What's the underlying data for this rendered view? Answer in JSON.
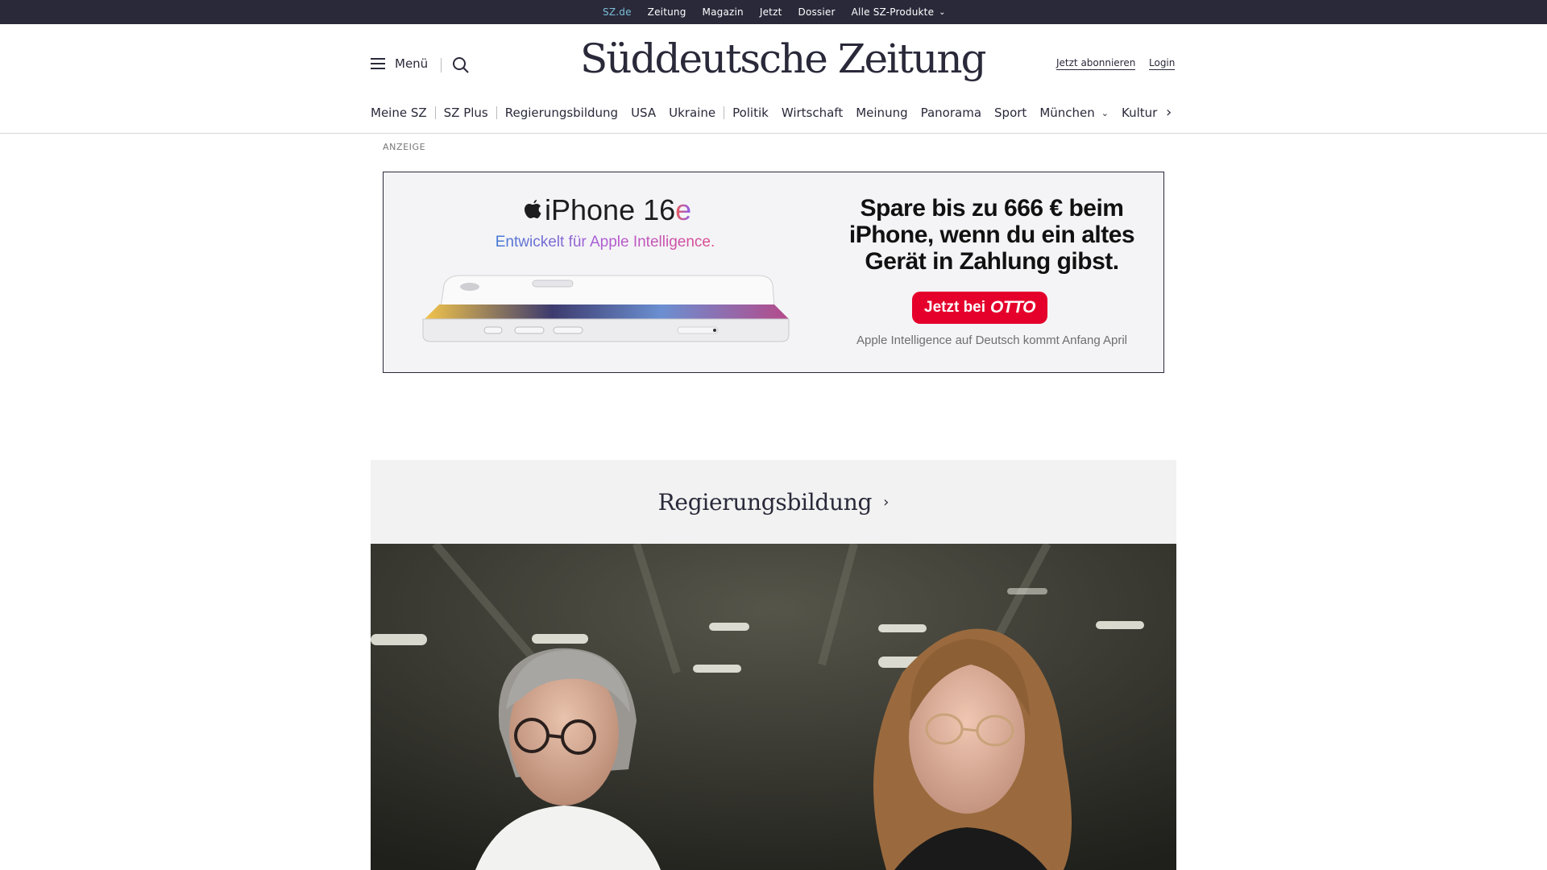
{
  "topbar": {
    "items": [
      "SZ.de",
      "Zeitung",
      "Magazin",
      "Jetzt",
      "Dossier",
      "Alle SZ-Produkte"
    ],
    "active": "SZ.de"
  },
  "header": {
    "menu_label": "Menü",
    "logo": "Süddeutsche Zeitung",
    "subscribe": "Jetzt abonnieren",
    "login": "Login"
  },
  "nav": {
    "items": [
      "Meine SZ",
      "SZ Plus",
      "Regierungsbildung",
      "USA",
      "Ukraine",
      "Politik",
      "Wirtschaft",
      "Meinung",
      "Panorama",
      "Sport",
      "München",
      "Kultur"
    ]
  },
  "ad": {
    "label": "ANZEIGE",
    "product": "iPhone 16",
    "product_suffix": "e",
    "subtitle": "Entwickelt für Apple Intelligence.",
    "headline": "Spare bis zu 666 € beim iPhone, wenn du ein altes Gerät in Zahlung gibst.",
    "cta_prefix": "Jetzt bei",
    "cta_brand": "OTTO",
    "footnote": "Apple Intelligence auf Deutsch kommt Anfang April",
    "cta_color": "#e4002b"
  },
  "section": {
    "title": "Regierungsbildung"
  },
  "colors": {
    "topbar_bg": "#29293a",
    "active_link": "#7cc0d8",
    "text": "#29293a"
  }
}
